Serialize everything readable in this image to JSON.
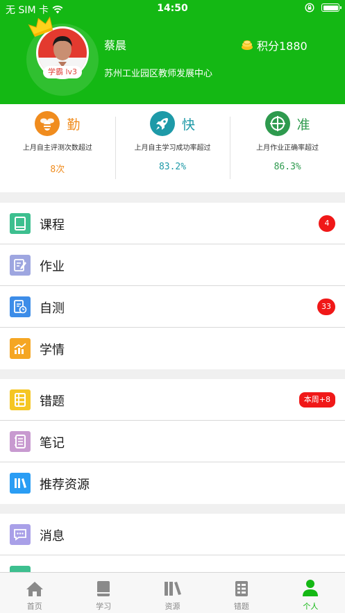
{
  "status_bar": {
    "carrier": "无 SIM 卡",
    "time": "14:50"
  },
  "profile": {
    "name": "蔡晨",
    "organization": "苏州工业园区教师发展中心",
    "level_badge": "学霸 lv3",
    "points": "积分1880"
  },
  "stats": [
    {
      "char": "勤",
      "description": "上月自主评测次数超过",
      "value": "8次",
      "color": "#f08c1e",
      "icon": "bee-icon"
    },
    {
      "char": "快",
      "description": "上月自主学习成功率超过",
      "value": "83.2%",
      "color": "#1e9aa8",
      "icon": "rocket-icon"
    },
    {
      "char": "准",
      "description": "上月作业正确率超过",
      "value": "86.3%",
      "color": "#2e9a4e",
      "icon": "target-icon"
    }
  ],
  "menu": {
    "course": {
      "label": "课程",
      "badge": "4",
      "icon": "book-icon",
      "color": "#3dbf8f"
    },
    "homework": {
      "label": "作业",
      "icon": "edit-icon",
      "color": "#9ea6e0"
    },
    "selftest": {
      "label": "自测",
      "badge": "33",
      "icon": "test-clock-icon",
      "color": "#3d8de8"
    },
    "progress": {
      "label": "学情",
      "icon": "chart-icon",
      "color": "#f5a623"
    },
    "mistakes": {
      "label": "错题",
      "badge": "本周+8",
      "icon": "list-icon",
      "color": "#f5c623"
    },
    "notes": {
      "label": "笔记",
      "icon": "notebook-icon",
      "color": "#c89ad0"
    },
    "resources": {
      "label": "推荐资源",
      "icon": "library-icon",
      "color": "#2a9df4"
    },
    "messages": {
      "label": "消息",
      "icon": "message-icon",
      "color": "#a9a0e8"
    }
  },
  "tabs": [
    {
      "label": "首页",
      "icon": "home-icon"
    },
    {
      "label": "学习",
      "icon": "book-icon"
    },
    {
      "label": "资源",
      "icon": "library-icon"
    },
    {
      "label": "错题",
      "icon": "list-icon"
    },
    {
      "label": "个人",
      "icon": "person-icon",
      "active": true
    }
  ],
  "accent_color": "#14b814"
}
